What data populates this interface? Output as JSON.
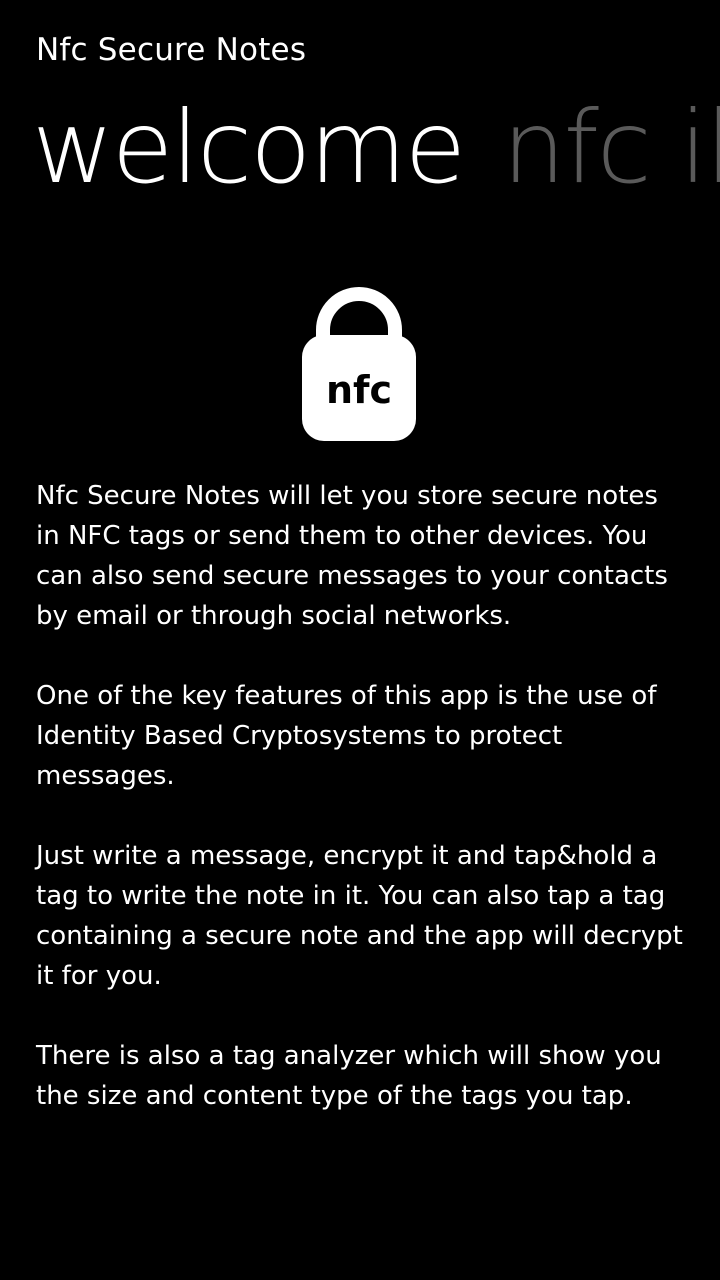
{
  "app": {
    "title": "Nfc Secure Notes"
  },
  "pivot": {
    "items": [
      "welcome",
      "nfc ib"
    ],
    "active_index": 0
  },
  "logo": {
    "text": "nfc",
    "icon": "lock-icon"
  },
  "colors": {
    "background": "#000000",
    "foreground": "#ffffff",
    "inactive_pivot": "#5a5a5a"
  },
  "content": {
    "paragraphs": [
      "Nfc Secure Notes will let you store secure notes in NFC tags or send them to other devices. You can also send secure messages to your contacts by email or through social networks.",
      "One of the key features of this app is the use of Identity Based Cryptosystems to protect messages.",
      "Just write a message, encrypt it and tap&hold a tag to write the note in it. You can also tap a tag containing a secure note and the app will decrypt it for you.",
      "There is also a tag analyzer which will show you the size and content type of the tags you tap."
    ]
  }
}
